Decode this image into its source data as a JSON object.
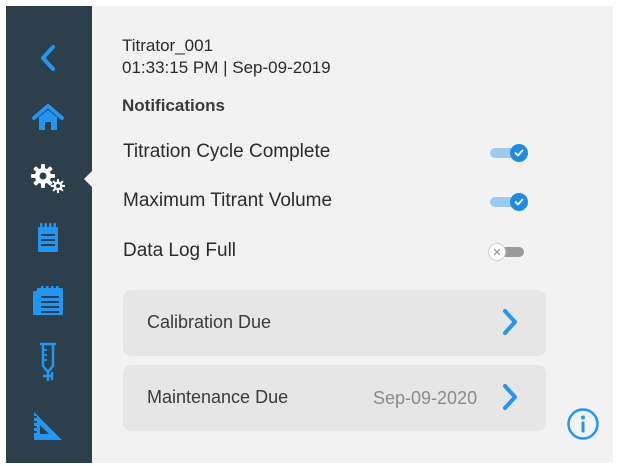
{
  "colors": {
    "sidebar_bg": "#2e3f4c",
    "icon_blue": "#2196f3",
    "content_bg": "#f2f2f2",
    "card_bg": "#e6e6e6",
    "toggle_on": "#1f8ce3",
    "toggle_off": "#9a9a9a"
  },
  "sidebar": {
    "items": [
      {
        "icon": "back-chevron-icon"
      },
      {
        "icon": "home-icon"
      },
      {
        "icon": "settings-gears-icon",
        "selected": true
      },
      {
        "icon": "notepad-icon"
      },
      {
        "icon": "document-stack-icon"
      },
      {
        "icon": "burette-icon"
      },
      {
        "icon": "ruler-triangle-icon"
      }
    ]
  },
  "header": {
    "device_name": "Titrator_001",
    "timestamp": "01:33:15 PM | Sep-09-2019"
  },
  "notifications": {
    "title": "Notifications",
    "items": [
      {
        "label": "Titration Cycle Complete",
        "enabled": true
      },
      {
        "label": "Maximum Titrant Volume",
        "enabled": true
      },
      {
        "label": "Data Log Full",
        "enabled": false
      }
    ]
  },
  "cards": [
    {
      "label": "Calibration Due",
      "value": ""
    },
    {
      "label": "Maintenance Due",
      "value": "Sep-09-2020"
    }
  ],
  "info_button": {
    "icon": "info-icon"
  }
}
